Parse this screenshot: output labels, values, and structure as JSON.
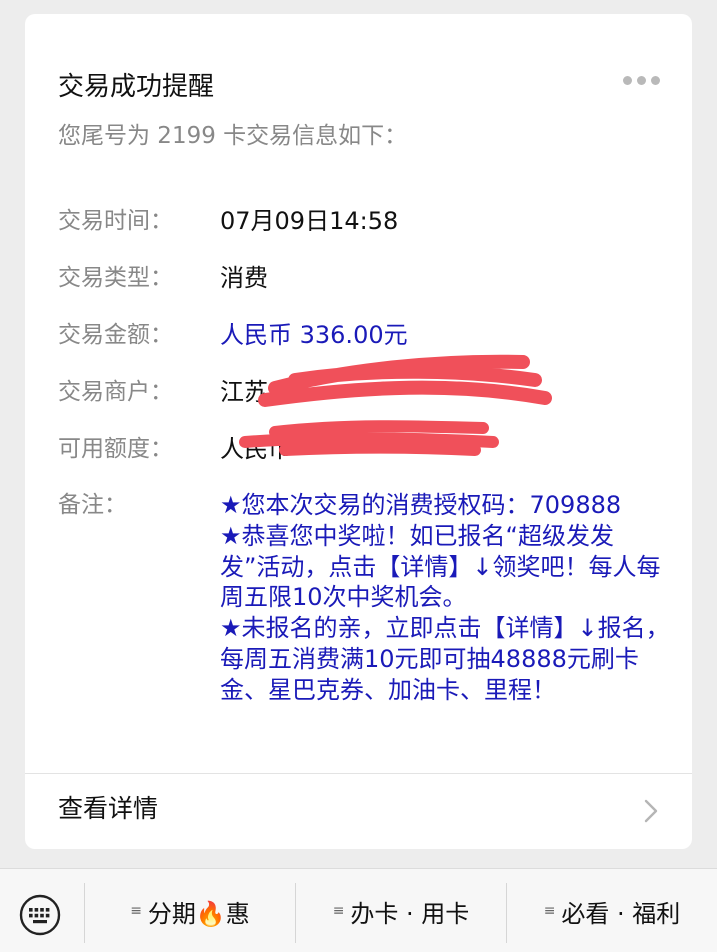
{
  "card": {
    "title": "交易成功提醒",
    "subtitle": "您尾号为 2199 卡交易信息如下：",
    "more_icon": "more-dots-icon",
    "rows": [
      {
        "label": "交易时间：",
        "value": "07月09日14:58"
      },
      {
        "label": "交易类型：",
        "value": "消费"
      },
      {
        "label": "交易金额：",
        "value": "人民币 336.00元"
      },
      {
        "label": "交易商户：",
        "value": "江苏"
      },
      {
        "label": "可用额度：",
        "value": "人民币"
      }
    ],
    "remark_label": "备注：",
    "remark_lines": [
      "★您本次交易的消费授权码：709888",
      "★恭喜您中奖啦！如已报名“超级发发发”活动，点击【详情】↓领奖吧！每人每周五限10次中奖机会。",
      "★未报名的亲，立即点击【详情】↓报名，每周五消费满10元即可抽48888元刷卡金、星巴克券、加油卡、里程！"
    ],
    "detail_label": "查看详情",
    "accent_color": "#1a1ab8",
    "redaction_color": "#f0505a"
  },
  "bottom_menu": {
    "keyboard_icon": "keyboard-icon",
    "items": [
      {
        "label": "分期🔥惠"
      },
      {
        "label": "办卡 · 用卡"
      },
      {
        "label": "必看 · 福利"
      }
    ]
  }
}
